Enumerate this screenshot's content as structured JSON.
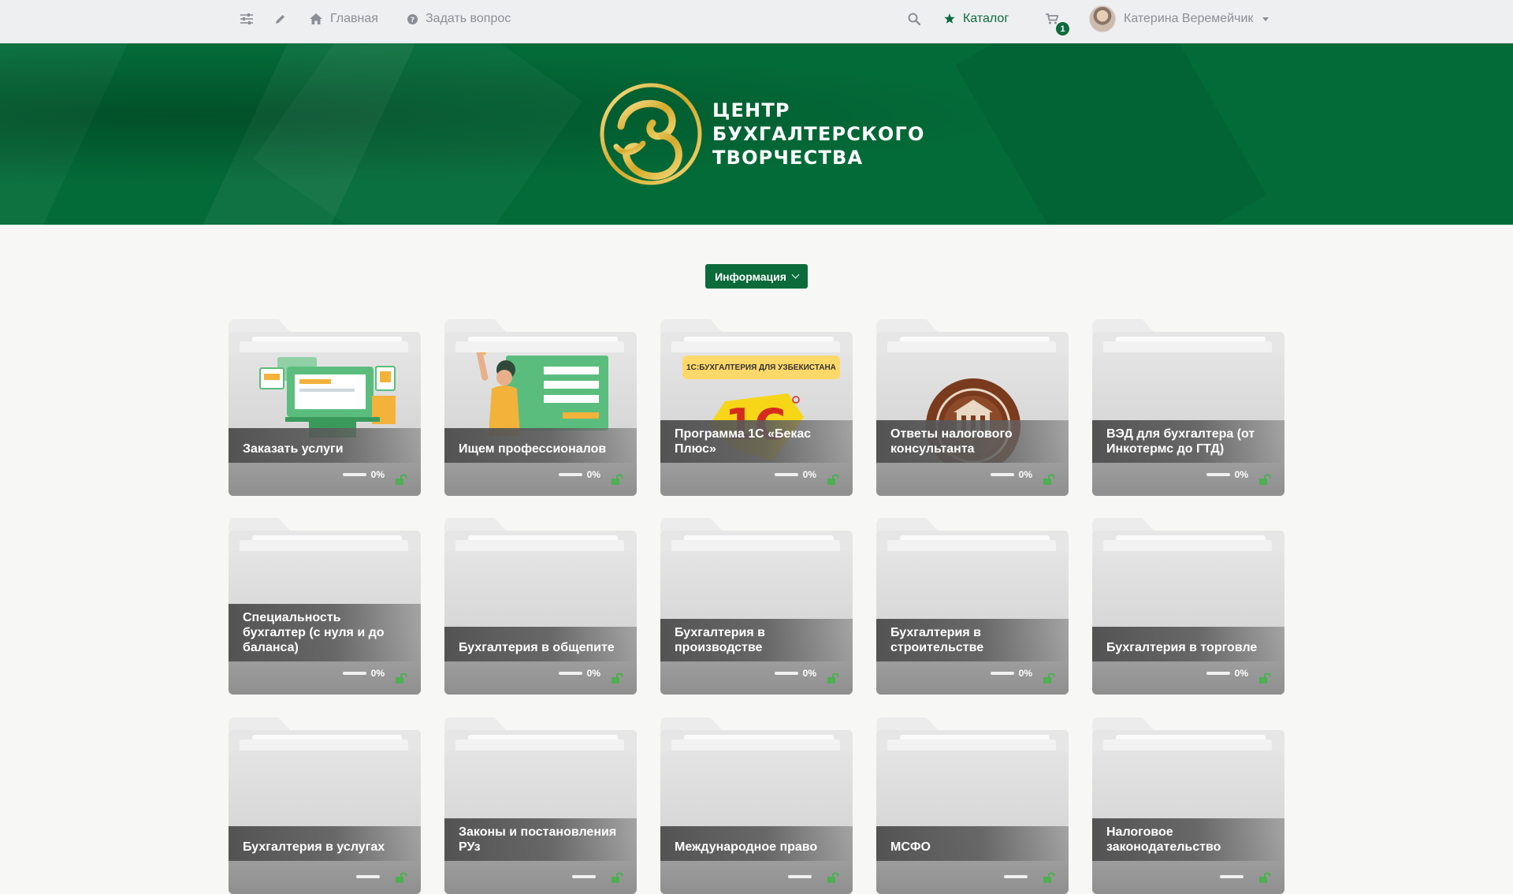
{
  "topbar": {
    "home_label": "Главная",
    "ask_label": "Задать вопрос",
    "catalog_label": "Каталог",
    "cart_count": "1",
    "user_name": "Катерина Веремейчик"
  },
  "banner": {
    "logo_line1": "ЦЕНТР",
    "logo_line2": "БУХГАЛТЕРСКОГО",
    "logo_line3": "ТВОРЧЕСТВА"
  },
  "filter_button": {
    "label": "Информация"
  },
  "colors": {
    "brand_green": "#0b6b3a",
    "lock_green": "#4caf50",
    "badge_yellow": "#ffd86a"
  },
  "cards": [
    {
      "title": "Заказать услуги",
      "progress_label": "0%",
      "progress": 0,
      "illustration": "services-illustration"
    },
    {
      "title": "Ищем профессионалов",
      "progress_label": "0%",
      "progress": 0,
      "illustration": "hiring-illustration"
    },
    {
      "title": "Программа 1С «Бекас Плюс»",
      "progress_label": "0%",
      "progress": 0,
      "illustration": "1c-logo",
      "badge": "1С:БУХГАЛТЕРИЯ ДЛЯ УЗБЕКИСТАНА"
    },
    {
      "title": "Ответы налогового консультанта",
      "progress_label": "0%",
      "progress": 0,
      "illustration": "seal-stamp"
    },
    {
      "title": "ВЭД для бухгалтера (от Инкотермс до ГТД)",
      "progress_label": "0%",
      "progress": 0
    },
    {
      "title": "Специальность бухгалтер (с нуля и до баланса)",
      "progress_label": "0%",
      "progress": 0
    },
    {
      "title": "Бухгалтерия в общепите",
      "progress_label": "0%",
      "progress": 0
    },
    {
      "title": "Бухгалтерия в производстве",
      "progress_label": "0%",
      "progress": 0
    },
    {
      "title": "Бухгалтерия в строительстве",
      "progress_label": "0%",
      "progress": 0
    },
    {
      "title": "Бухгалтерия в торговле",
      "progress_label": "0%",
      "progress": 0
    },
    {
      "title": "Бухгалтерия в услугах",
      "progress_label": "",
      "progress": 0
    },
    {
      "title": "Законы и постановления РУз",
      "progress_label": "",
      "progress": 0
    },
    {
      "title": "Международное право",
      "progress_label": "",
      "progress": 0
    },
    {
      "title": "МСФО",
      "progress_label": "",
      "progress": 0
    },
    {
      "title": "Налоговое законодательство",
      "progress_label": "",
      "progress": 0
    }
  ]
}
